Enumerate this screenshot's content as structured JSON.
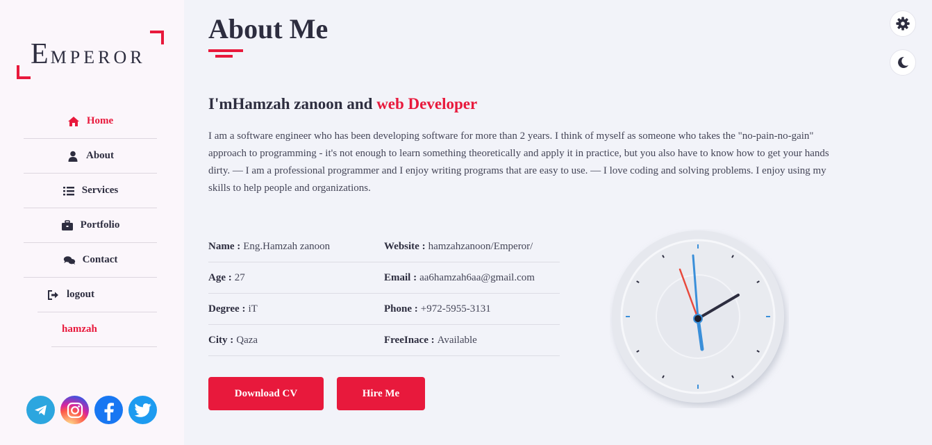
{
  "logo": {
    "first_letter": "E",
    "rest": "MPEROR"
  },
  "nav": {
    "items": [
      {
        "label": "Home",
        "icon": "home-icon"
      },
      {
        "label": "About",
        "icon": "user-icon"
      },
      {
        "label": "Services",
        "icon": "list-icon"
      },
      {
        "label": "Portfolio",
        "icon": "briefcase-icon"
      },
      {
        "label": "Contact",
        "icon": "comments-icon"
      },
      {
        "label": "logout",
        "icon": "sign-out-icon"
      }
    ],
    "user": "hamzah"
  },
  "socials": [
    "telegram-icon",
    "instagram-icon",
    "facebook-icon",
    "twitter-icon"
  ],
  "page": {
    "title": "About Me",
    "headline_prefix": "I'mHamzah zanoon and ",
    "headline_accent": "web Developer",
    "bio": "I am a software engineer who has been developing software for more than 2 years. I think of myself as someone who takes the \"no-pain-no-gain\" approach to programming - it's not enough to learn something theoretically and apply it in practice, but you also have to know how to get your hands dirty. — I am a professional programmer and I enjoy writing programs that are easy to use. — I love coding and solving problems. I enjoy using my skills to help people and organizations."
  },
  "info": [
    {
      "k1": "Name :",
      "v1": "Eng.Hamzah zanoon",
      "k2": "Website :",
      "v2": "hamzahzanoon/Emperor/"
    },
    {
      "k1": "Age :",
      "v1": "27",
      "k2": "Email :",
      "v2": "aa6hamzah6aa@gmail.com"
    },
    {
      "k1": "Degree :",
      "v1": "iT",
      "k2": "Phone :",
      "v2": "+972-5955-3131"
    },
    {
      "k1": "City :",
      "v1": "Qaza",
      "k2": "FreeInace :",
      "v2": "Available"
    }
  ],
  "buttons": {
    "cv": "Download CV",
    "hire": "Hire Me"
  },
  "colors": {
    "accent": "#e8193c",
    "text": "#2d2d3f",
    "sidebar_bg": "#fbf6fb",
    "main_bg": "#f2f3f9"
  }
}
